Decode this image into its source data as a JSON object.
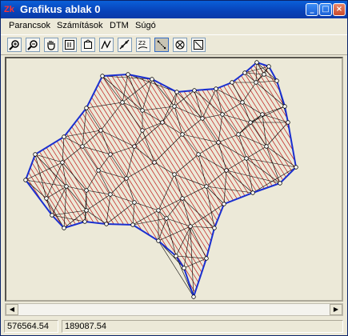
{
  "window": {
    "icon_text": "Zk",
    "title": "Grafikus ablak 0",
    "buttons": {
      "minimize": "_",
      "maximize": "□",
      "close": "×"
    }
  },
  "menu": [
    "Parancsok",
    "Számítások",
    "DTM",
    "Súgó"
  ],
  "toolbar": {
    "tools": [
      {
        "icon": "zoom-in-icon"
      },
      {
        "icon": "zoom-out-icon"
      },
      {
        "icon": "pan-hand-icon"
      },
      {
        "icon": "zoom-extent-icon"
      },
      {
        "icon": "zoom-window-icon"
      },
      {
        "icon": "draw-line-icon"
      },
      {
        "icon": "triangle-edge-icon"
      },
      {
        "icon": "contour-z-icon"
      },
      {
        "icon": "select-points-icon"
      },
      {
        "icon": "network-icon"
      },
      {
        "icon": "clear-icon"
      }
    ],
    "active_tool": "select-points-icon"
  },
  "colors": {
    "boundary": "#1a2fd0",
    "contour": "#c01818",
    "triangle": "#000000",
    "background": "#ece9d8"
  },
  "scrollbar": {
    "left_arrow": "◀",
    "right_arrow": "▶"
  },
  "status": {
    "x": "576564.54",
    "y": "189087.54"
  }
}
